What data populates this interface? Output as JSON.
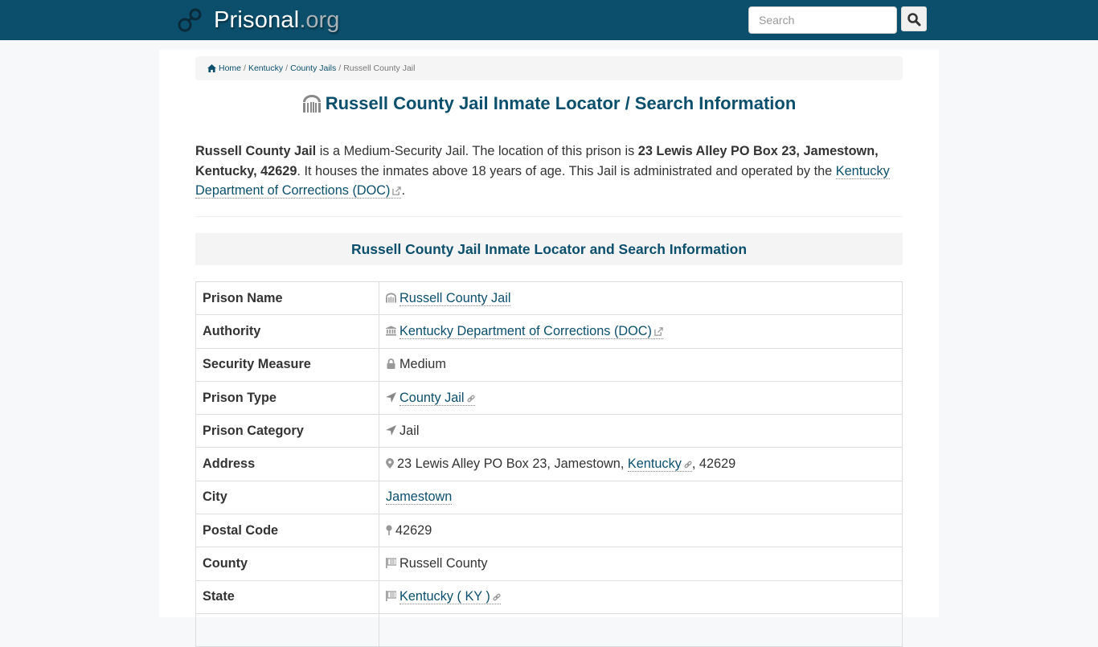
{
  "navbar": {
    "brand_name": "Prisonal",
    "brand_tld": ".org",
    "search_placeholder": "Search",
    "search_value": ""
  },
  "breadcrumb": {
    "items": [
      {
        "label": "Home",
        "link": true
      },
      {
        "label": "Kentucky",
        "link": true
      },
      {
        "label": "County Jails",
        "link": true
      },
      {
        "label": "Russell County Jail",
        "link": false
      }
    ],
    "separator": "/"
  },
  "page_title": "Russell County Jail Inmate Locator / Search Information",
  "intro": {
    "name": "Russell County Jail",
    "text1": " is a Medium-Security Jail. The location of this prison is ",
    "address_bold": "23 Lewis Alley PO Box 23, Jamestown, Kentucky, 42629",
    "text2": ". It houses the inmates above 18 years of age. This Jail is administrated and operated by the ",
    "authority_link": "Kentucky Department of Corrections (DOC)",
    "text3": "."
  },
  "section_heading": "Russell County Jail Inmate Locator and Search Information",
  "info_table": {
    "prison_name": {
      "label": "Prison Name",
      "value": "Russell County Jail"
    },
    "authority": {
      "label": "Authority",
      "value": "Kentucky Department of Corrections (DOC)"
    },
    "security": {
      "label": "Security Measure",
      "value": "Medium"
    },
    "prison_type": {
      "label": "Prison Type",
      "value": "County Jail"
    },
    "category": {
      "label": "Prison Category",
      "value": "Jail"
    },
    "address": {
      "label": "Address",
      "street": "23 Lewis Alley PO Box 23, Jamestown, ",
      "state_link": "Kentucky",
      "zip": ", 42629"
    },
    "city": {
      "label": "City",
      "value": "Jamestown"
    },
    "postal": {
      "label": "Postal Code",
      "value": "42629"
    },
    "county": {
      "label": "County",
      "value": "Russell County"
    },
    "state": {
      "label": "State",
      "value": "Kentucky ( KY )"
    }
  }
}
